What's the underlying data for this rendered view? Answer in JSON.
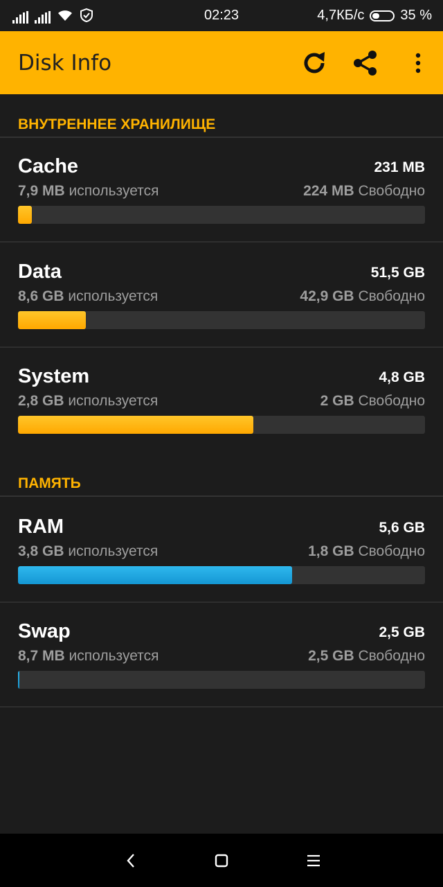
{
  "status_bar": {
    "time": "02:23",
    "speed": "4,7КБ/с",
    "battery": "35 %",
    "battery_level": 0.35
  },
  "toolbar": {
    "title": "Disk Info",
    "icons": [
      "refresh-icon",
      "share-icon",
      "more-vert-icon"
    ]
  },
  "sections": {
    "internal": {
      "header": "ВНУТРЕННЕЕ ХРАНИЛИЩЕ",
      "items": [
        {
          "name": "Cache",
          "total": "231 MB",
          "used_value": "7,9 MB",
          "used_label": "используется",
          "free_value": "224 MB",
          "free_label": "Свободно",
          "used_fraction": 0.034,
          "color": "#ffb300"
        },
        {
          "name": "Data",
          "total": "51,5 GB",
          "used_value": "8,6 GB",
          "used_label": "используется",
          "free_value": "42,9 GB",
          "free_label": "Свободно",
          "used_fraction": 0.167,
          "color": "#ffb300"
        },
        {
          "name": "System",
          "total": "4,8 GB",
          "used_value": "2,8 GB",
          "used_label": "используется",
          "free_value": "2 GB",
          "free_label": "Свободно",
          "used_fraction": 0.578,
          "color": "#ffb300"
        }
      ]
    },
    "memory": {
      "header": "ПАМЯТЬ",
      "items": [
        {
          "name": "RAM",
          "total": "5,6 GB",
          "used_value": "3,8 GB",
          "used_label": "используется",
          "free_value": "1,8 GB",
          "free_label": "Свободно",
          "used_fraction": 0.674,
          "color": "#1ea6e0"
        },
        {
          "name": "Swap",
          "total": "2,5 GB",
          "used_value": "8,7 MB",
          "used_label": "используется",
          "free_value": "2,5 GB",
          "free_label": "Свободно",
          "used_fraction": 0.004,
          "color": "#1ea6e0"
        }
      ]
    }
  },
  "nav_bar": {
    "icons": [
      "back-icon",
      "home-icon",
      "menu-icon"
    ]
  }
}
